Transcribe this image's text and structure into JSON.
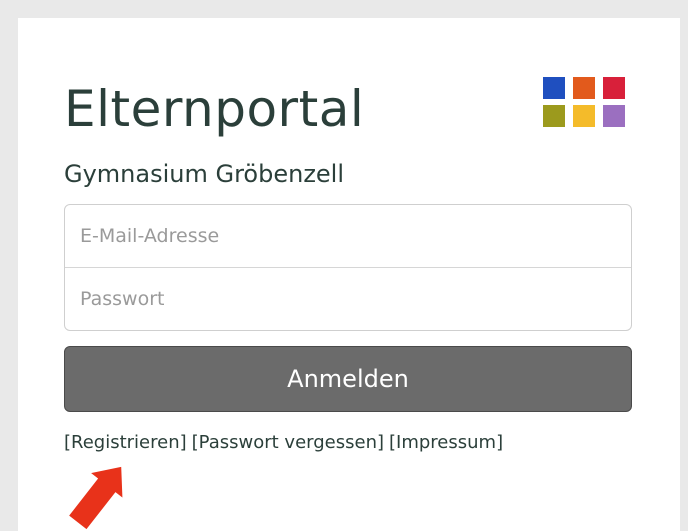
{
  "portal": {
    "title": "Elternportal",
    "school": "Gymnasium Gröbenzell"
  },
  "logo": {
    "icon": "color-grid-logo-icon",
    "colors": [
      "#1f4fbf",
      "#e25a1c",
      "#d8203a",
      "#9c9a1d",
      "#f4bb2a",
      "#9b6fc0"
    ]
  },
  "form": {
    "email_placeholder": "E-Mail-Adresse",
    "password_placeholder": "Passwort",
    "submit_label": "Anmelden"
  },
  "links": {
    "register": "[Registrieren]",
    "forgot_password": "[Passwort vergessen]",
    "imprint": "[Impressum]"
  },
  "annotation": {
    "icon": "red-arrow-icon",
    "color": "#e8321a"
  }
}
